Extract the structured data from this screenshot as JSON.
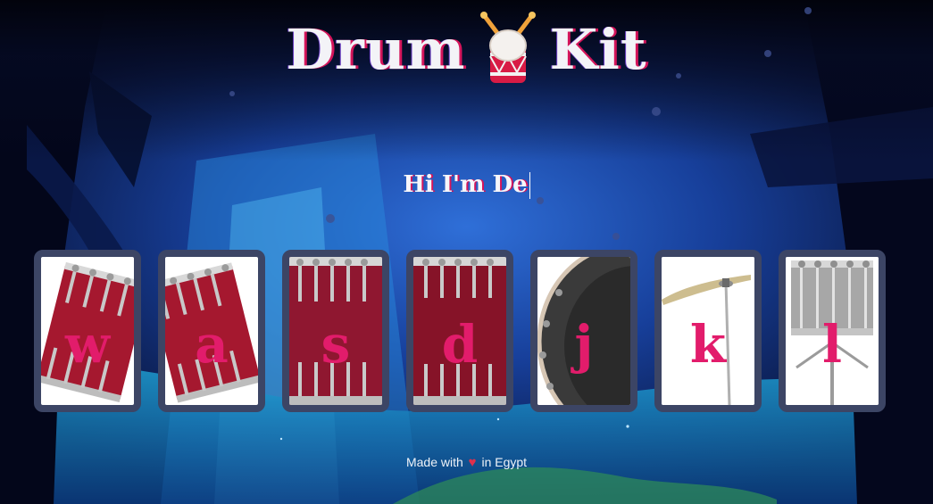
{
  "header": {
    "title_left": "Drum",
    "title_right": "Kit",
    "logo_icon": "drum-icon",
    "subtitle": "Hi I'm De"
  },
  "drums": [
    {
      "key": "w",
      "instrument": "tom-tilted-left"
    },
    {
      "key": "a",
      "instrument": "tom-tilted-right"
    },
    {
      "key": "s",
      "instrument": "snare"
    },
    {
      "key": "d",
      "instrument": "kick"
    },
    {
      "key": "j",
      "instrument": "crash"
    },
    {
      "key": "k",
      "instrument": "cymbal"
    },
    {
      "key": "l",
      "instrument": "silver-drum"
    }
  ],
  "footer": {
    "made_with": "Made with",
    "heart_icon": "heart-icon",
    "in_text": "in Egypt"
  },
  "colors": {
    "accent": "#e21c6b",
    "card_border": "#3c4565",
    "drum_red": "#9e1b35"
  }
}
